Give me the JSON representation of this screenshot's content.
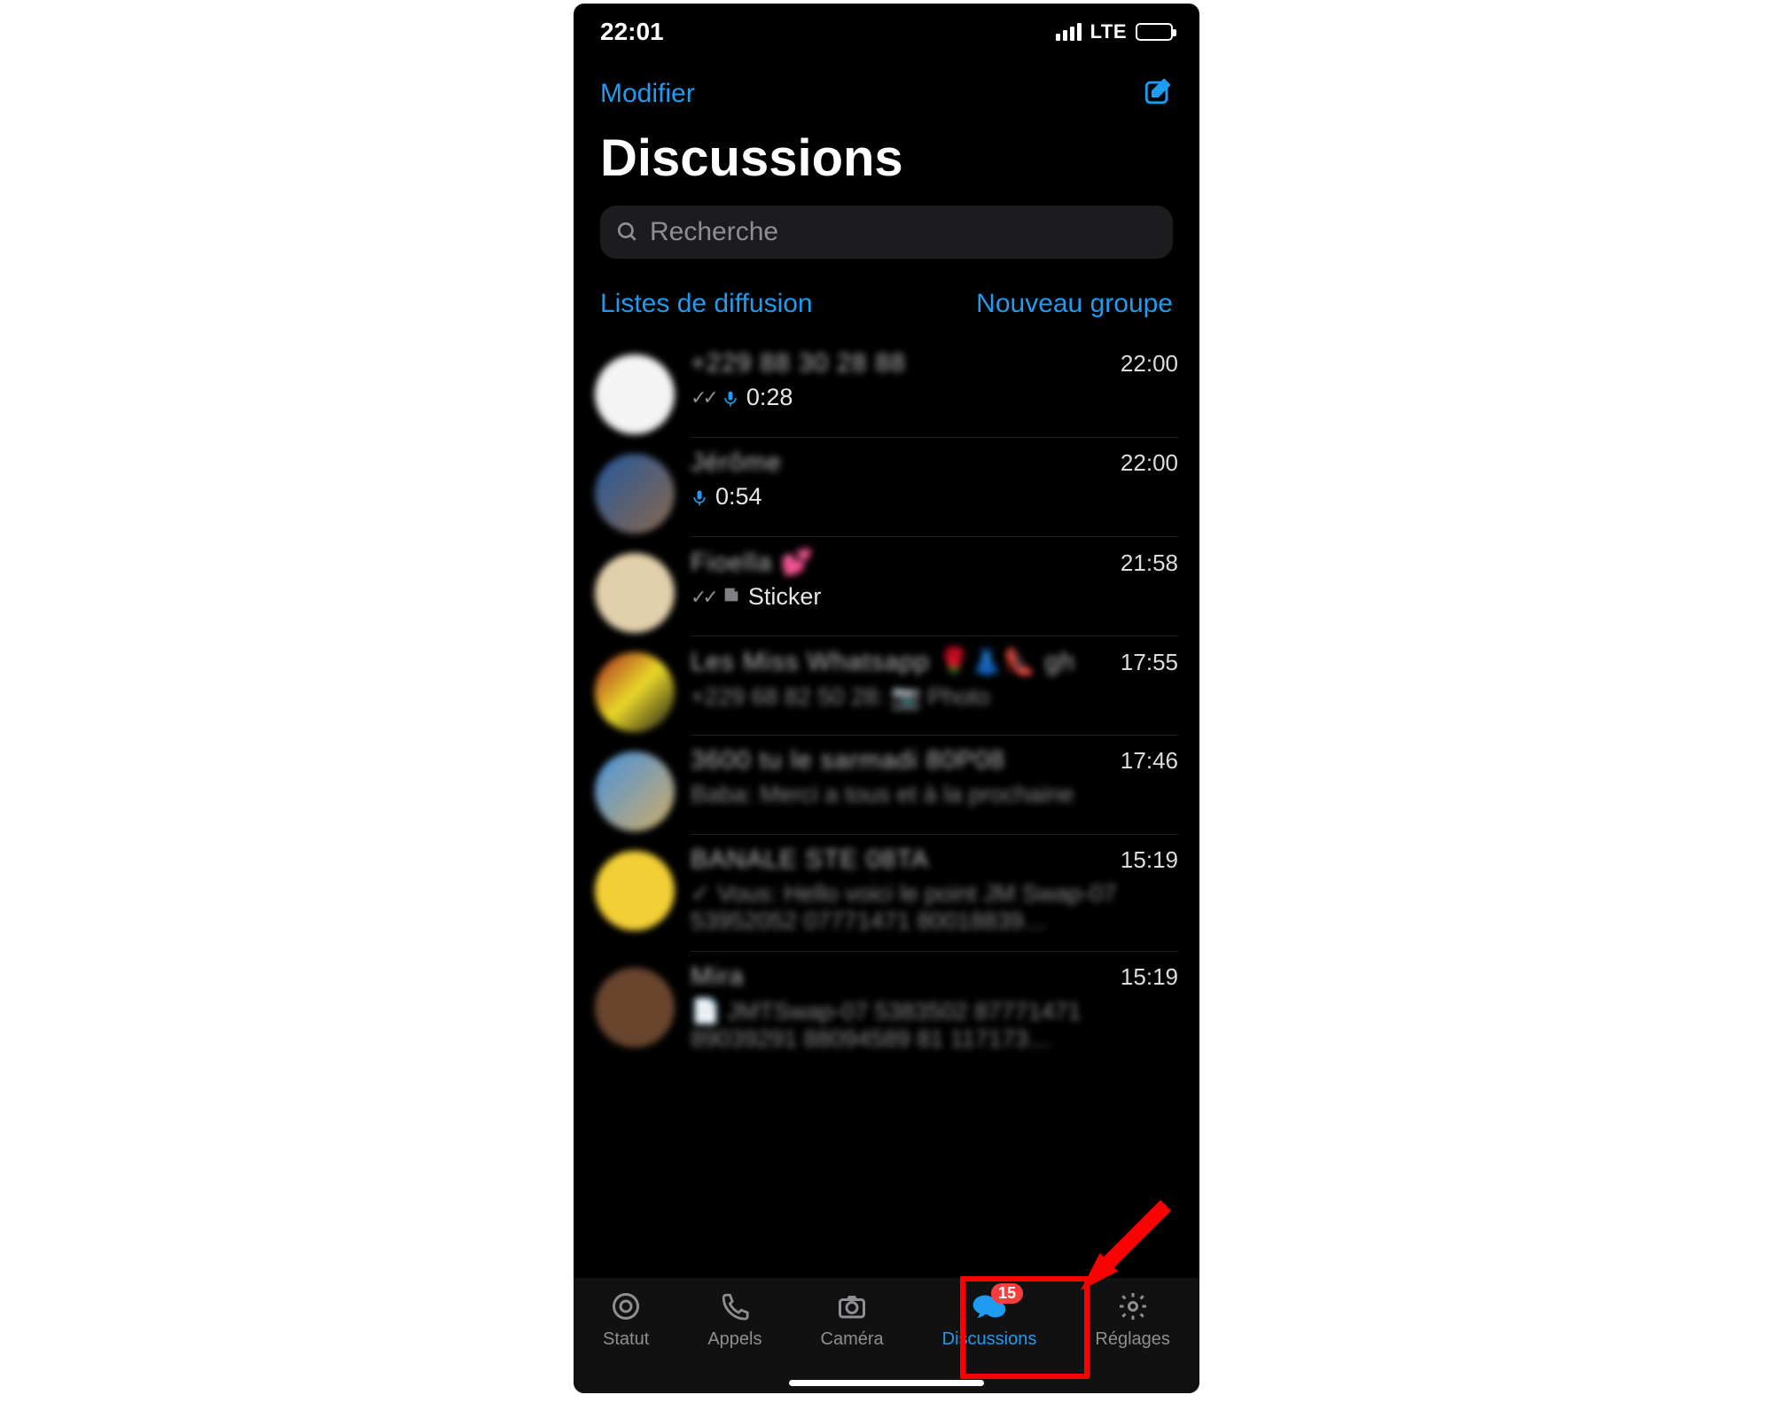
{
  "statusbar": {
    "time": "22:01",
    "network": "LTE"
  },
  "nav": {
    "edit": "Modifier"
  },
  "title": "Discussions",
  "search": {
    "placeholder": "Recherche"
  },
  "links": {
    "broadcast": "Listes de diffusion",
    "newgroup": "Nouveau groupe"
  },
  "chats": [
    {
      "name": "+229 88 30 28 88",
      "time": "22:00",
      "voice": "0:28",
      "showTicks": true,
      "micBlue": true
    },
    {
      "name": "Jérôme",
      "time": "22:00",
      "voice": "0:54",
      "showTicks": false,
      "micBlue": true
    },
    {
      "name": "Fioella 💕",
      "time": "21:58",
      "sticker": "Sticker",
      "showTicks": true
    },
    {
      "name": "Les Miss Whatsapp 🌹👗👠 gh",
      "time": "17:55",
      "line2": "+229 68 82 50 28: 📷 Photo"
    },
    {
      "name": "3600 tu le sarmadi 80P08",
      "time": "17:46",
      "line2": "Baba: Merci a tous et à la prochaine"
    },
    {
      "name": "BANALE STE 08TA",
      "time": "15:19",
      "line2": "✓ Vous: Hello voici le point JM Swap-07 53952052 07771471 80018839…"
    },
    {
      "name": "Mira",
      "time": "15:19",
      "line2": "📄 JMTSwap-07 5383502 87771471 89039291 88094589 81 117173…"
    }
  ],
  "tabs": {
    "status": "Statut",
    "calls": "Appels",
    "camera": "Caméra",
    "discussions": "Discussions",
    "settings": "Réglages",
    "badge": "15"
  }
}
